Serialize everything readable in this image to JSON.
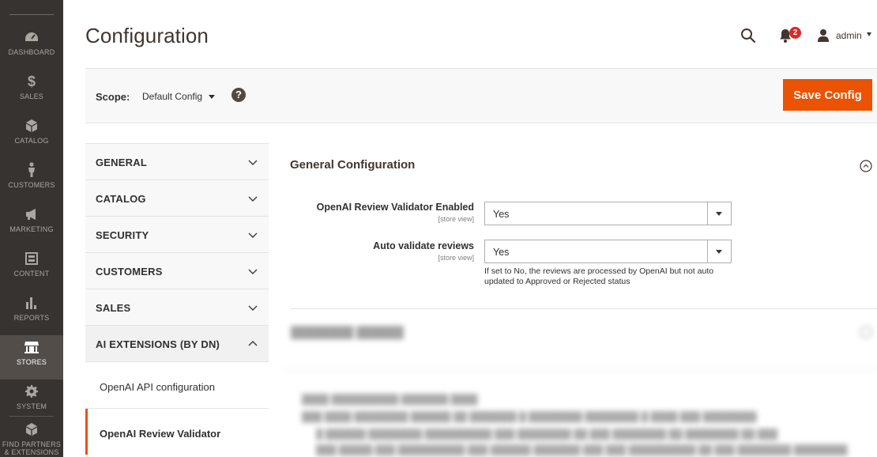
{
  "menu": {
    "items": [
      {
        "label": "DASHBOARD",
        "icon": "dashboard-icon"
      },
      {
        "label": "SALES",
        "icon": "dollar-icon"
      },
      {
        "label": "CATALOG",
        "icon": "cube-icon"
      },
      {
        "label": "CUSTOMERS",
        "icon": "person-icon"
      },
      {
        "label": "MARKETING",
        "icon": "megaphone-icon"
      },
      {
        "label": "CONTENT",
        "icon": "layout-icon"
      },
      {
        "label": "REPORTS",
        "icon": "bar-chart-icon"
      },
      {
        "label": "STORES",
        "icon": "store-icon"
      },
      {
        "label": "SYSTEM",
        "icon": "gear-icon"
      },
      {
        "label": "FIND PARTNERS & EXTENSIONS",
        "icon": "box-icon"
      }
    ],
    "active": "STORES"
  },
  "header": {
    "title": "Configuration",
    "notifications_count": "2",
    "user": "admin"
  },
  "scope": {
    "label": "Scope:",
    "value": "Default Config",
    "help": "?",
    "save_label": "Save Config"
  },
  "tabs": [
    {
      "label": "GENERAL",
      "open": false
    },
    {
      "label": "CATALOG",
      "open": false
    },
    {
      "label": "SECURITY",
      "open": false
    },
    {
      "label": "CUSTOMERS",
      "open": false
    },
    {
      "label": "SALES",
      "open": false
    },
    {
      "label": "AI EXTENSIONS (BY DN)",
      "open": true
    }
  ],
  "subtabs": [
    {
      "label": "OpenAI API configuration",
      "active": false
    },
    {
      "label": "OpenAI Review Validator",
      "active": true
    }
  ],
  "section": {
    "title": "General Configuration",
    "fields": [
      {
        "label": "OpenAI Review Validator Enabled",
        "scope": "[store view]",
        "value": "Yes"
      },
      {
        "label": "Auto validate reviews",
        "scope": "[store view]",
        "value": "Yes"
      }
    ],
    "note": "If set to No, the reviews are processed by OpenAI but not auto updated to Approved or Rejected status"
  },
  "colors": {
    "accent": "#eb5202",
    "sidebar": "#373330",
    "badge": "#e22626"
  }
}
